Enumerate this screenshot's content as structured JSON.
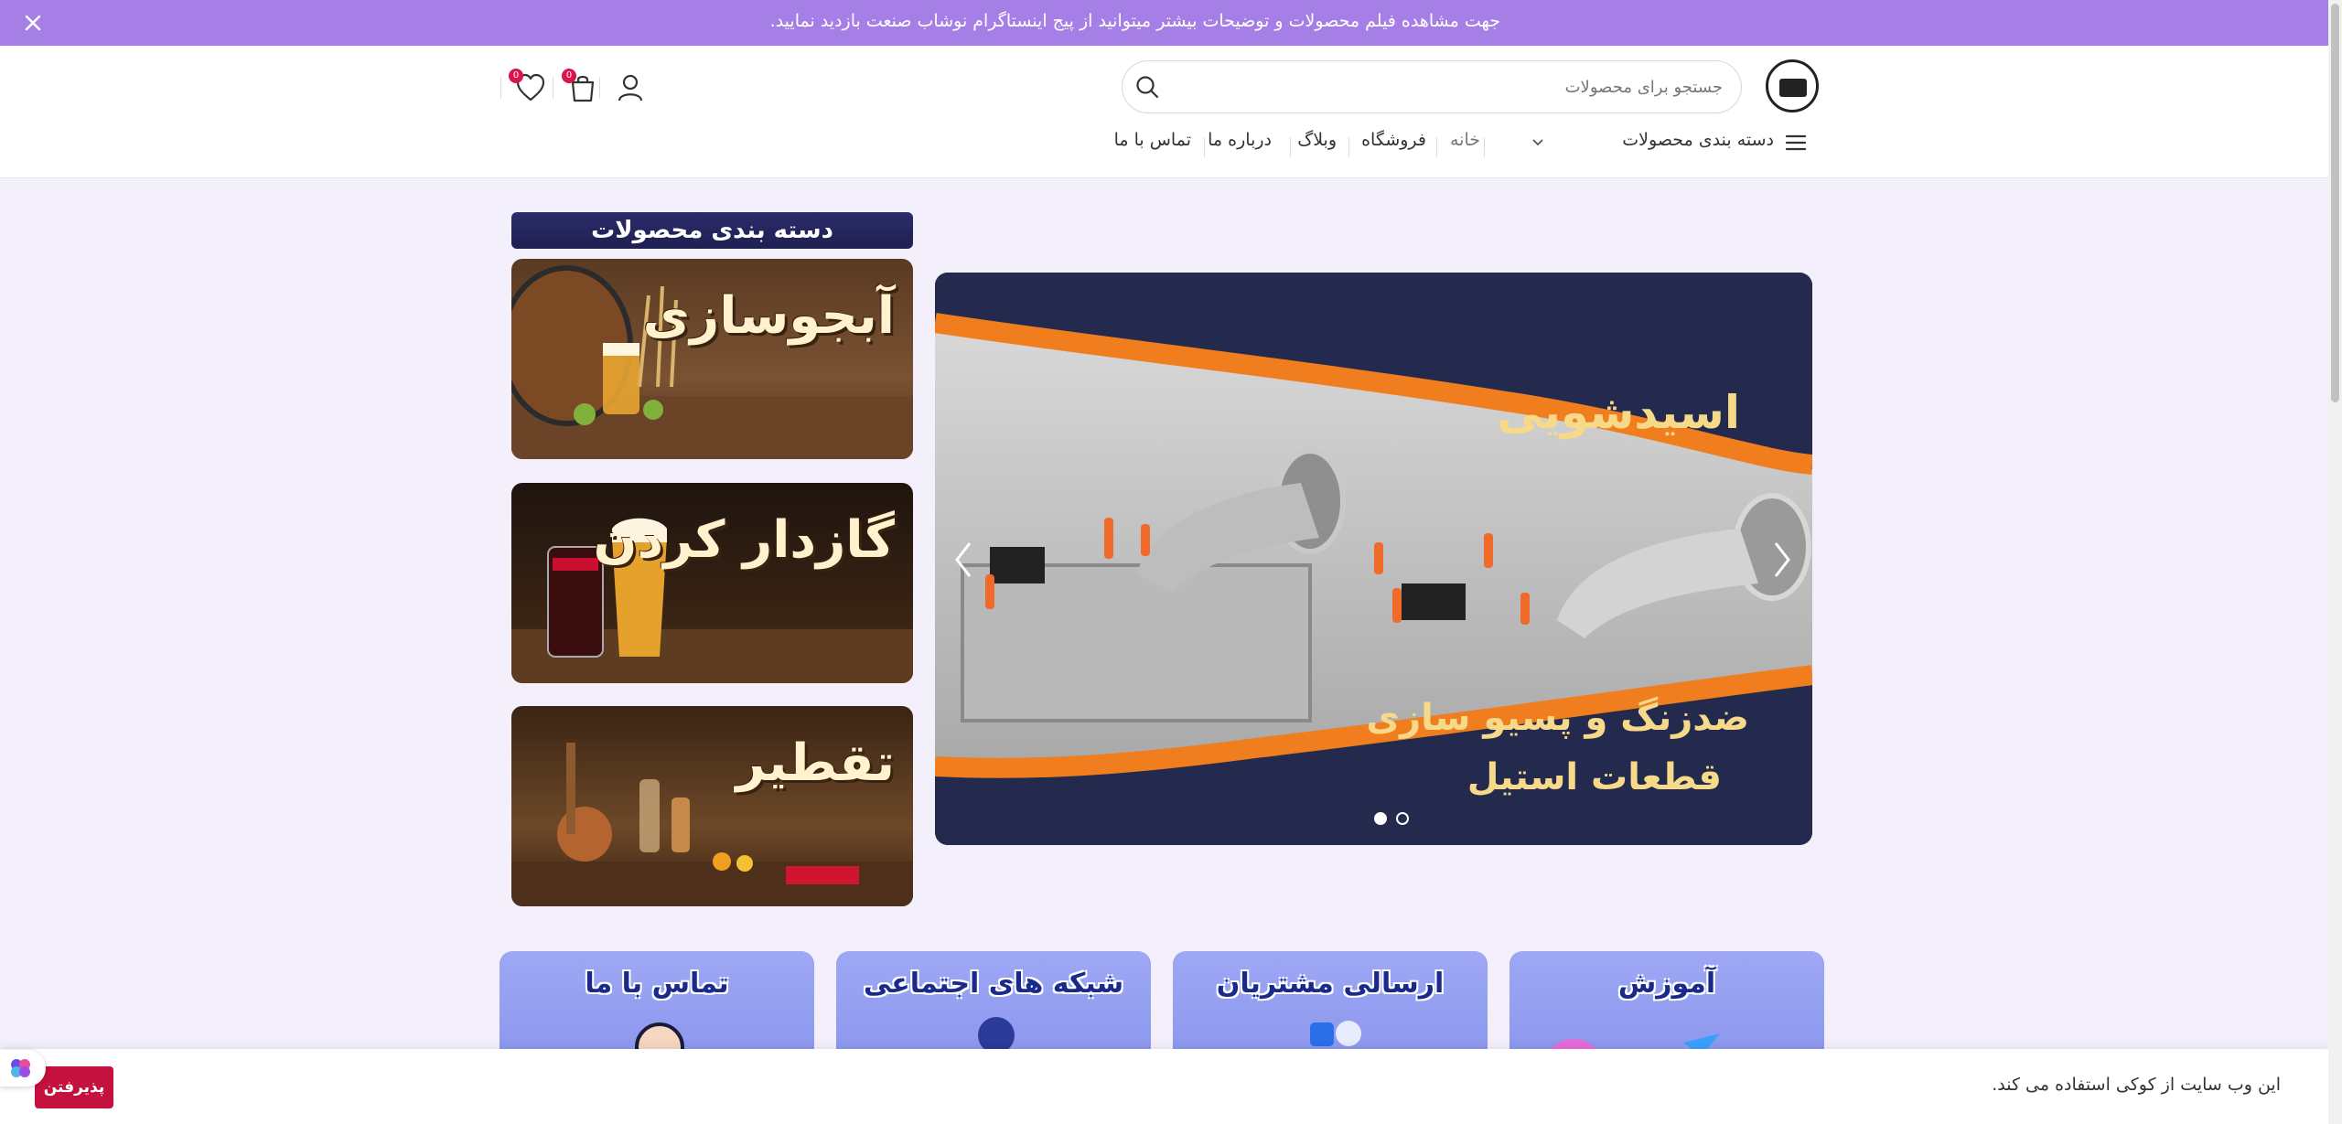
{
  "promo": {
    "text": "جهت مشاهده فیلم محصولات و توضیحات بیشتر میتوانید از پیج اینستاگرام نوشاب صنعت بازدید نمایید."
  },
  "header": {
    "search_placeholder": "جستجو برای محصولات",
    "cart_count": "0",
    "wishlist_count": "0"
  },
  "nav": {
    "categories_label": "دسته بندی محصولات",
    "items": [
      {
        "label": "خانه"
      },
      {
        "label": "فروشگاه"
      },
      {
        "label": "وبلاگ"
      },
      {
        "label": "درباره ما"
      },
      {
        "label": "تماس با ما"
      }
    ]
  },
  "slider": {
    "headline": "اسیدشویی",
    "subline1": "ضدزنگ و پسیو سازی",
    "subline2": "قطعات استیل",
    "active_slide": 1,
    "slide_count": 2
  },
  "categories": {
    "title": "دسته بندی محصولات",
    "cards": [
      {
        "label": "آبجوسازی"
      },
      {
        "label": "گازدار کردن"
      },
      {
        "label": "تقطیر"
      }
    ]
  },
  "features": [
    {
      "title": "تماس با ما"
    },
    {
      "title": "شبکه های اجتماعی"
    },
    {
      "title": "ارسالی مشتریان"
    },
    {
      "title": "آموزش"
    }
  ],
  "cookie": {
    "text": "این وب سایت از کوکی استفاده می کند.",
    "accept_label": "پذیرفتن"
  },
  "colors": {
    "promo_bg": "#a67fe6",
    "accent_red": "#c4113d",
    "slider_navy": "#232a4d",
    "slider_orange": "#f07e1f"
  }
}
